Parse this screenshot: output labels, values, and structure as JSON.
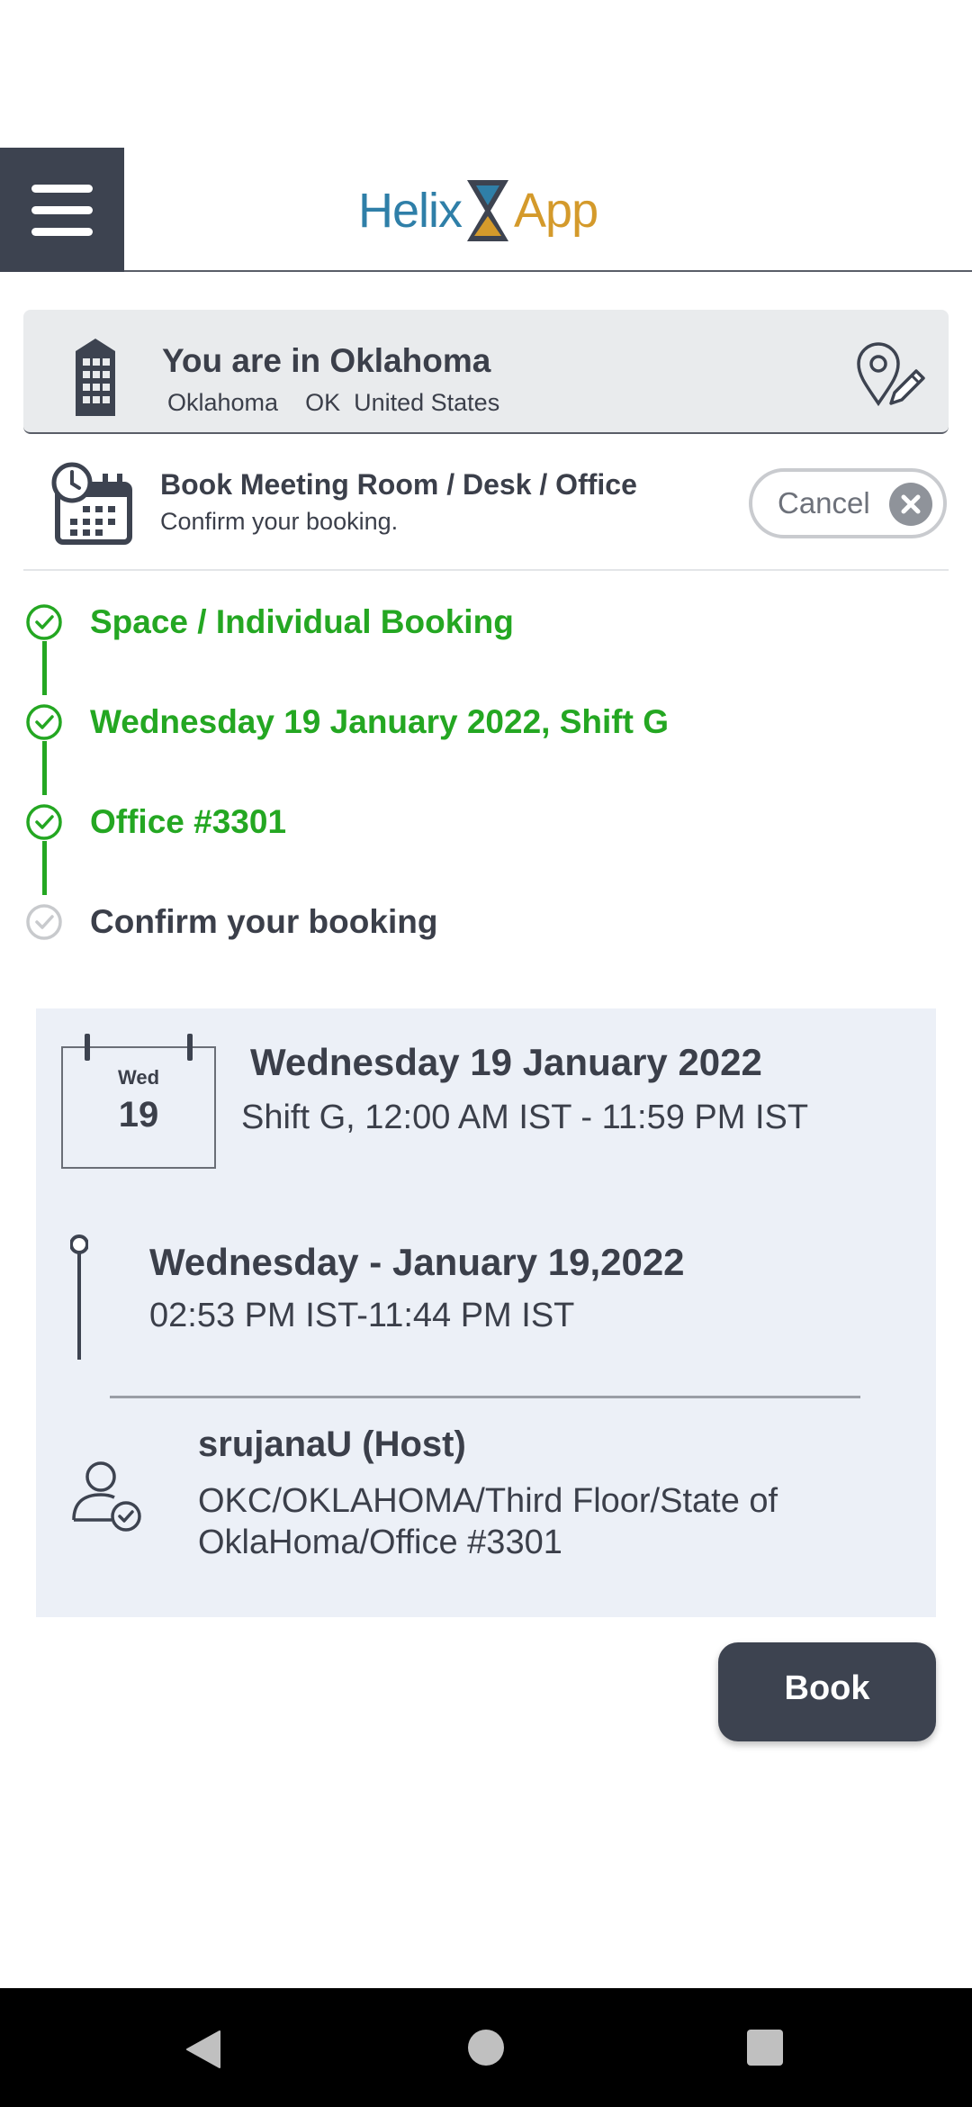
{
  "header": {
    "menu_icon": "hamburger-menu-icon",
    "logo": {
      "left_text": "Helix",
      "right_text": "App",
      "left_color": "#2f7fa8",
      "right_color": "#d49a2b"
    }
  },
  "location": {
    "title": "You are in Oklahoma",
    "city": "Oklahoma",
    "state": "OK",
    "country": "United States",
    "icons": [
      "building-icon",
      "location-edit-icon"
    ]
  },
  "booking_header": {
    "title": "Book Meeting Room / Desk / Office",
    "subtitle": "Confirm your booking.",
    "cancel_label": "Cancel"
  },
  "steps": [
    {
      "label": "Space / Individual Booking",
      "status": "done"
    },
    {
      "label": "Wednesday 19 January 2022, Shift G",
      "status": "done"
    },
    {
      "label": "Office #3301",
      "status": "done"
    },
    {
      "label": "Confirm your booking",
      "status": "current"
    }
  ],
  "details": {
    "calendar_day": "Wed",
    "calendar_date": "19",
    "date_title": "Wednesday 19 January 2022",
    "shift": "Shift G, 12:00 AM IST - 11:59 PM IST",
    "time_title": "Wednesday - January 19,2022",
    "time_range": "02:53 PM IST-11:44 PM IST",
    "host_name": "srujanaU (Host)",
    "host_path": "OKC/OKLAHOMA/Third Floor/State of OklaHoma/Office #3301"
  },
  "actions": {
    "book_label": "Book"
  },
  "colors": {
    "accent_dark": "#3d4350",
    "success": "#24a722",
    "card_bg": "#ecf0f7"
  },
  "navbar": {
    "icons": [
      "back-icon",
      "home-icon",
      "recents-icon"
    ]
  }
}
